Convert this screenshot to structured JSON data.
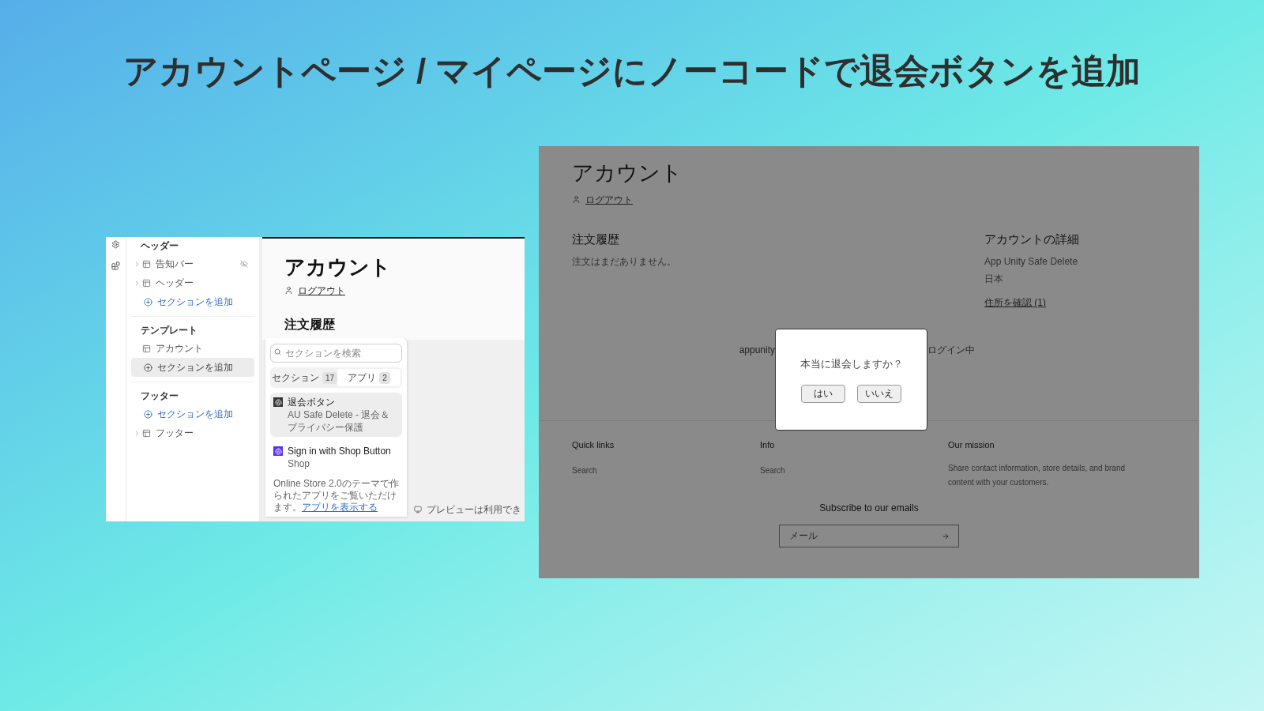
{
  "headline": "アカウントページ / マイページにノーコードで退会ボタンを追加",
  "editor": {
    "sidebar_sections": [
      {
        "heading": "ヘッダー",
        "items": [
          {
            "kind": "section",
            "label": "告知バー",
            "expandable": true,
            "hidden": true
          },
          {
            "kind": "section",
            "label": "ヘッダー",
            "expandable": true,
            "hidden": false
          },
          {
            "kind": "add",
            "label": "セクションを追加",
            "selected": false
          }
        ]
      },
      {
        "heading": "テンプレート",
        "items": [
          {
            "kind": "section",
            "label": "アカウント",
            "expandable": false,
            "hidden": false
          },
          {
            "kind": "add",
            "label": "セクションを追加",
            "selected": true
          }
        ]
      },
      {
        "heading": "フッター",
        "items": [
          {
            "kind": "add",
            "label": "セクションを追加",
            "selected": false
          },
          {
            "kind": "section",
            "label": "フッター",
            "expandable": true,
            "hidden": false
          }
        ]
      }
    ],
    "preview": {
      "title": "アカウント",
      "logout": "ログアウト",
      "heading": "注文履歴",
      "notice": "プレビューは利用でき"
    },
    "picker": {
      "search_placeholder": "セクションを検索",
      "tabs": [
        {
          "label": "セクション",
          "count": "17",
          "selected": false
        },
        {
          "label": "アプリ",
          "count": "2",
          "selected": true
        }
      ],
      "apps": [
        {
          "name": "退会ボタン",
          "source": "AU Safe Delete - 退会＆プライバシー保護",
          "color": "#333333",
          "selected": true
        },
        {
          "name": "Sign in with Shop Button",
          "source": "Shop",
          "color": "#5a31f4",
          "selected": false
        }
      ],
      "footnote": "Online Store 2.0のテーマで作られたアプリをご覧いただけます。",
      "footnote_link": "アプリを表示する"
    }
  },
  "store": {
    "title": "アカウント",
    "logout": "ログアウト",
    "orders_heading": "注文履歴",
    "orders_empty": "注文はまだありません。",
    "details_heading": "アカウントの詳細",
    "details_lines": [
      "App Unity Safe Delete",
      "日本"
    ],
    "addresses_link": "住所を確認 (1)",
    "login_status_left": "appunity",
    "login_status_right": "ログイン中",
    "dialog": {
      "message": "本当に退会しますか？",
      "buttons": [
        "はい",
        "いいえ"
      ]
    },
    "footer": {
      "columns": [
        {
          "heading": "Quick links",
          "links": [
            "Search"
          ]
        },
        {
          "heading": "Info",
          "links": [
            "Search"
          ]
        },
        {
          "heading": "Our mission",
          "text": "Share contact information, store details, and brand content with your customers."
        }
      ],
      "subscribe_heading": "Subscribe to our emails",
      "email_placeholder": "メール"
    }
  }
}
